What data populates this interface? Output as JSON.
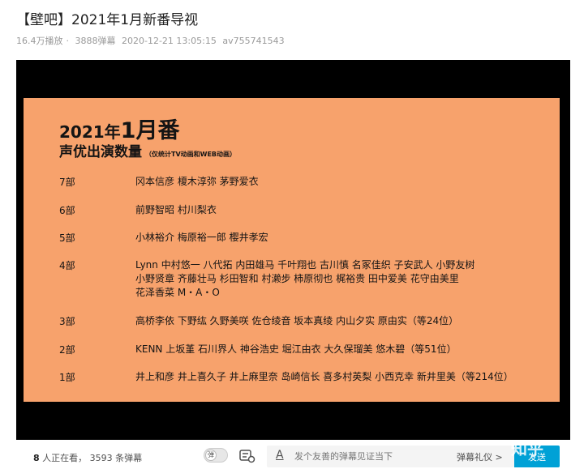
{
  "video": {
    "title": "【壁吧】2021年1月新番导视",
    "plays": "16.4万播放",
    "danmaku_count": "3888弹幕",
    "date": "2020-12-21 13:05:15",
    "av": "av755741543"
  },
  "slide": {
    "year_text": "2021年",
    "month_text": "1月番",
    "subtitle": "声优出演数量",
    "note": "（仅统计TV动画和WEB动画）",
    "rows": [
      {
        "count": "7部",
        "lines": [
          "冈本信彦 榎木淳弥 茅野爱衣"
        ]
      },
      {
        "count": "6部",
        "lines": [
          "前野智昭 村川梨衣"
        ]
      },
      {
        "count": "5部",
        "lines": [
          "小林裕介 梅原裕一郎 樱井孝宏"
        ]
      },
      {
        "count": "4部",
        "lines": [
          "Lynn 中村悠一 八代拓 内田雄马 千叶翔也 古川慎 名冢佳织 子安武人 小野友树",
          "小野贤章 齐藤壮马 杉田智和 村濑步 柿原彻也 梶裕贵 田中爱美 花守由美里",
          "花泽香菜 M・A・O"
        ]
      },
      {
        "count": "3部",
        "lines": [
          "高桥李依 下野纮 久野美咲 佐仓绫音 坂本真绫 内山夕实 原由实（等24位）"
        ]
      },
      {
        "count": "2部",
        "lines": [
          "KENN 上坂堇 石川界人 神谷浩史 堀江由衣 大久保瑠美 悠木碧（等51位）"
        ]
      },
      {
        "count": "1部",
        "lines": [
          "井上和彦 井上喜久子 井上麻里奈 岛崎信长 喜多村英梨 小西克幸 新井里美（等214位）"
        ]
      }
    ]
  },
  "controls": {
    "viewers_num": "8",
    "viewers_text": " 人正在看，",
    "danmaku_text": "3593 条弹幕",
    "toggle_label": "弹",
    "input_placeholder": "发个友善的弹幕见证当下",
    "etiquette": "弹幕礼仪 >",
    "send": "发送"
  },
  "watermark": "知乎",
  "colors": {
    "slide_bg": "#f7a26c",
    "player_bg": "#000000",
    "send_bg": "#00a1d6"
  }
}
